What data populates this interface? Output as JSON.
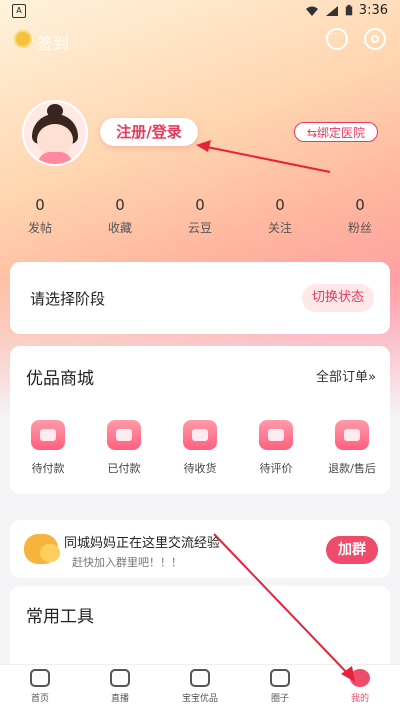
{
  "status_bar": {
    "left_icon": "A",
    "time": "3:36"
  },
  "header": {
    "checkin_label": "签到",
    "message_icon": "message-icon",
    "settings_icon": "gear-icon"
  },
  "profile": {
    "login_label": "注册/登录",
    "bind_hospital_label": "⇆绑定医院"
  },
  "stats": [
    {
      "value": "0",
      "label": "发帖"
    },
    {
      "value": "0",
      "label": "收藏"
    },
    {
      "value": "0",
      "label": "云豆"
    },
    {
      "value": "0",
      "label": "关注"
    },
    {
      "value": "0",
      "label": "粉丝"
    }
  ],
  "stage": {
    "prompt": "请选择阶段",
    "switch_label": "切换状态"
  },
  "mall": {
    "title": "优品商城",
    "all_orders": "全部订单»",
    "orders": [
      {
        "label": "待付款",
        "icon": "wallet-icon"
      },
      {
        "label": "已付款",
        "icon": "package-icon"
      },
      {
        "label": "待收货",
        "icon": "truck-icon"
      },
      {
        "label": "待评价",
        "icon": "comment-icon"
      },
      {
        "label": "退款/售后",
        "icon": "refund-icon"
      }
    ]
  },
  "group": {
    "title": "同城妈妈正在这里交流经验",
    "subtitle": "赶快加入群里吧！！！",
    "join_label": "加群"
  },
  "tools": {
    "title": "常用工具"
  },
  "tabbar": {
    "items": [
      {
        "label": "首页"
      },
      {
        "label": "直播"
      },
      {
        "label": "宝宝优品"
      },
      {
        "label": "圈子"
      },
      {
        "label": "我的"
      }
    ]
  },
  "colors": {
    "accent": "#ef4b6a",
    "text": "#222222"
  }
}
